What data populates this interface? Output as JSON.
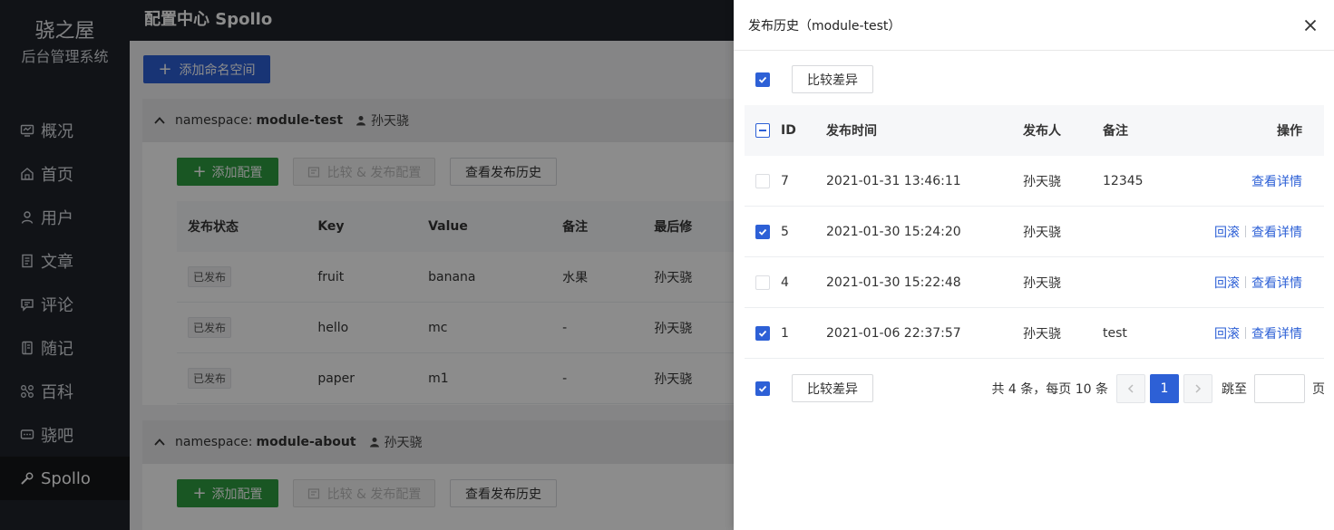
{
  "sidebar": {
    "brand_title": "骁之屋",
    "brand_subtitle": "后台管理系统",
    "items": [
      {
        "label": "概况",
        "icon": "dashboard-icon"
      },
      {
        "label": "首页",
        "icon": "home-icon"
      },
      {
        "label": "用户",
        "icon": "user-icon"
      },
      {
        "label": "文章",
        "icon": "article-icon"
      },
      {
        "label": "评论",
        "icon": "comment-icon"
      },
      {
        "label": "随记",
        "icon": "note-icon"
      },
      {
        "label": "百科",
        "icon": "wiki-icon"
      },
      {
        "label": "骁吧",
        "icon": "forum-icon"
      },
      {
        "label": "Spollo",
        "icon": "wrench-icon"
      }
    ]
  },
  "header": {
    "title": "配置中心 Spollo"
  },
  "main": {
    "add_namespace_label": "添加命名空间",
    "namespaces": [
      {
        "prefix": "namespace:",
        "name": "module-test",
        "owner": "孙天骁",
        "add_config_label": "添加配置",
        "compare_publish_label": "比较 & 发布配置",
        "history_label": "查看发布历史"
      },
      {
        "prefix": "namespace:",
        "name": "module-about",
        "owner": "孙天骁",
        "add_config_label": "添加配置",
        "compare_publish_label": "比较 & 发布配置",
        "history_label": "查看发布历史"
      }
    ],
    "config_table": {
      "columns": [
        "发布状态",
        "Key",
        "Value",
        "备注",
        "最后修"
      ],
      "rows": [
        {
          "status": "已发布",
          "key": "fruit",
          "value": "banana",
          "note": "水果",
          "modifier": "孙天骁"
        },
        {
          "status": "已发布",
          "key": "hello",
          "value": "mc",
          "note": "-",
          "modifier": "孙天骁"
        },
        {
          "status": "已发布",
          "key": "paper",
          "value": "m1",
          "note": "-",
          "modifier": "孙天骁"
        }
      ]
    }
  },
  "drawer": {
    "title": "发布历史（module-test）",
    "compare_label": "比较差异",
    "columns": {
      "id": "ID",
      "time": "发布时间",
      "publisher": "发布人",
      "note": "备注",
      "op": "操作"
    },
    "rows": [
      {
        "id": "7",
        "time": "2021-01-31 13:46:11",
        "publisher": "孙天骁",
        "note": "12345",
        "checked": false,
        "rollback": "",
        "detail": "查看详情"
      },
      {
        "id": "5",
        "time": "2021-01-30 15:24:20",
        "publisher": "孙天骁",
        "note": "",
        "checked": true,
        "rollback": "回滚",
        "detail": "查看详情"
      },
      {
        "id": "4",
        "time": "2021-01-30 15:22:48",
        "publisher": "孙天骁",
        "note": "",
        "checked": false,
        "rollback": "回滚",
        "detail": "查看详情"
      },
      {
        "id": "1",
        "time": "2021-01-06 22:37:57",
        "publisher": "孙天骁",
        "note": "test",
        "checked": true,
        "rollback": "回滚",
        "detail": "查看详情"
      }
    ],
    "pagination": {
      "total_text": "共 4 条，每页 10 条",
      "current_page": "1",
      "jump_label": "跳至",
      "page_suffix": "页",
      "jump_value": ""
    }
  },
  "colors": {
    "primary": "#2d60d6",
    "success": "#2f9d40",
    "sidebar_bg": "#20242b"
  }
}
